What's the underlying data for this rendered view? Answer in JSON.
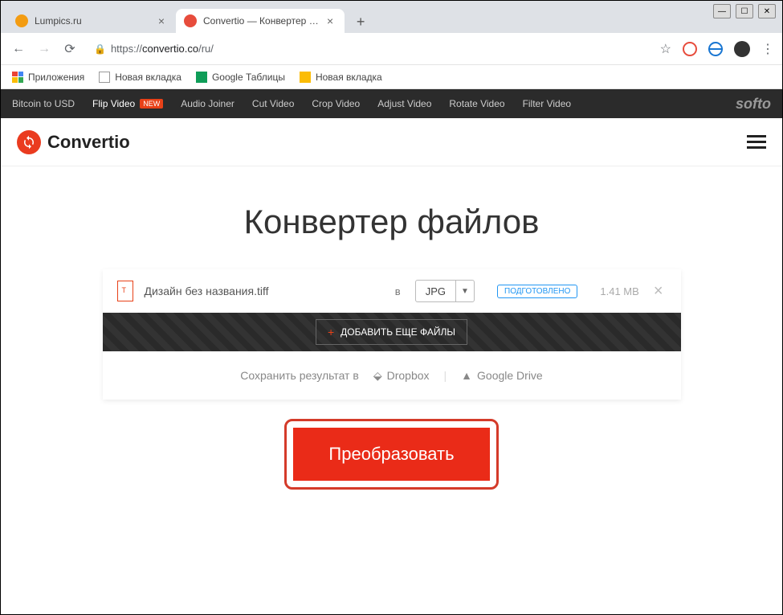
{
  "window": {
    "minimize": "—",
    "maximize": "☐",
    "close": "✕"
  },
  "tabs": [
    {
      "title": "Lumpics.ru",
      "active": false
    },
    {
      "title": "Convertio — Конвертер файлов",
      "active": true
    }
  ],
  "addressbar": {
    "url_proto": "https://",
    "url_host": "convertio.co",
    "url_path": "/ru/"
  },
  "bookmarks": {
    "apps": "Приложения",
    "items": [
      "Новая вкладка",
      "Google Таблицы",
      "Новая вкладка"
    ]
  },
  "utilbar": {
    "links": [
      "Bitcoin to USD",
      "Flip Video",
      "Audio Joiner",
      "Cut Video",
      "Crop Video",
      "Adjust Video",
      "Rotate Video",
      "Filter Video"
    ],
    "new_badge": "NEW",
    "brand": "softo"
  },
  "site": {
    "brand": "Convertio"
  },
  "hero": {
    "title": "Конвертер файлов"
  },
  "file": {
    "name": "Дизайн без названия.tiff",
    "in_label": "в",
    "format": "JPG",
    "status": "ПОДГОТОВЛЕНО",
    "size": "1.41 MB"
  },
  "add_more": "ДОБАВИТЬ ЕЩЕ ФАЙЛЫ",
  "save": {
    "label": "Сохранить результат в",
    "dropbox": "Dropbox",
    "gdrive": "Google Drive"
  },
  "convert": "Преобразовать"
}
